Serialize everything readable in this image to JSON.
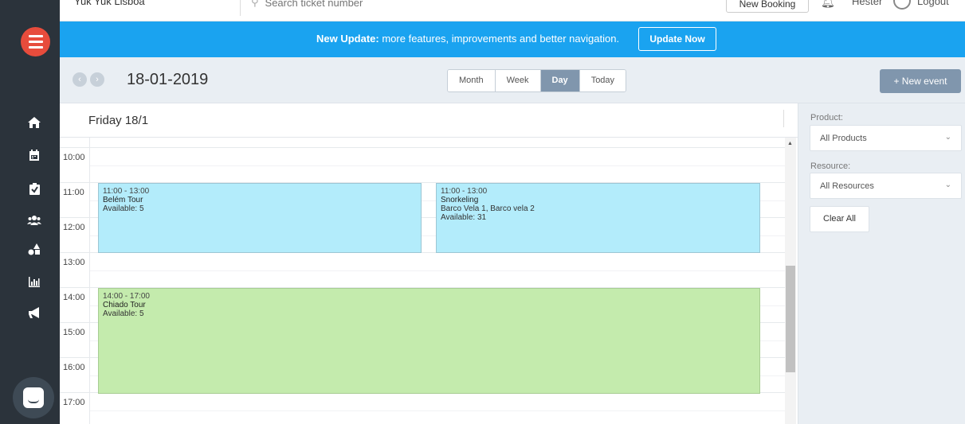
{
  "topbar": {
    "company": "Yuk Yuk Lisboa",
    "search_placeholder": "Search ticket number",
    "new_booking": "New Booking",
    "user": "Hester",
    "logout": "Logout"
  },
  "banner": {
    "title": "New Update:",
    "message": " more features, improvements and better navigation.",
    "button": "Update Now"
  },
  "toolbar": {
    "date": "18-01-2019",
    "prev": "‹",
    "next": "›",
    "views": [
      "Month",
      "Week",
      "Day",
      "Today"
    ],
    "active_view": "Day",
    "new_event": "+ New event"
  },
  "calendar": {
    "day_title": "Friday 18/1",
    "hours": [
      "10:00",
      "11:00",
      "12:00",
      "13:00",
      "14:00",
      "15:00",
      "16:00",
      "17:00"
    ],
    "events": [
      {
        "time": "11:00 - 13:00",
        "name": "Belém Tour",
        "detail": "",
        "availability": "Available: 5",
        "color": "#b3ecfb"
      },
      {
        "time": "11:00 - 13:00",
        "name": "Snorkeling",
        "detail": "Barco Vela 1, Barco vela 2",
        "availability": "Available: 31",
        "color": "#b3ecfb"
      },
      {
        "time": "14:00 - 17:00",
        "name": "Chiado Tour",
        "detail": "",
        "availability": "Available: 5",
        "color": "#c4ebad"
      }
    ]
  },
  "filters": {
    "product_label": "Product:",
    "product_value": "All Products",
    "resource_label": "Resource:",
    "resource_value": "All Resources",
    "clear": "Clear All"
  },
  "sidebar": {
    "icons": [
      "home-icon",
      "calendar-icon",
      "clipboard-icon",
      "users-icon",
      "shapes-icon",
      "bar-chart-icon",
      "megaphone-icon"
    ],
    "colors": {
      "background": "#2b333b",
      "logo": "#e74c3c",
      "banner": "#1aa3f0",
      "accent": "#8096ad"
    }
  }
}
